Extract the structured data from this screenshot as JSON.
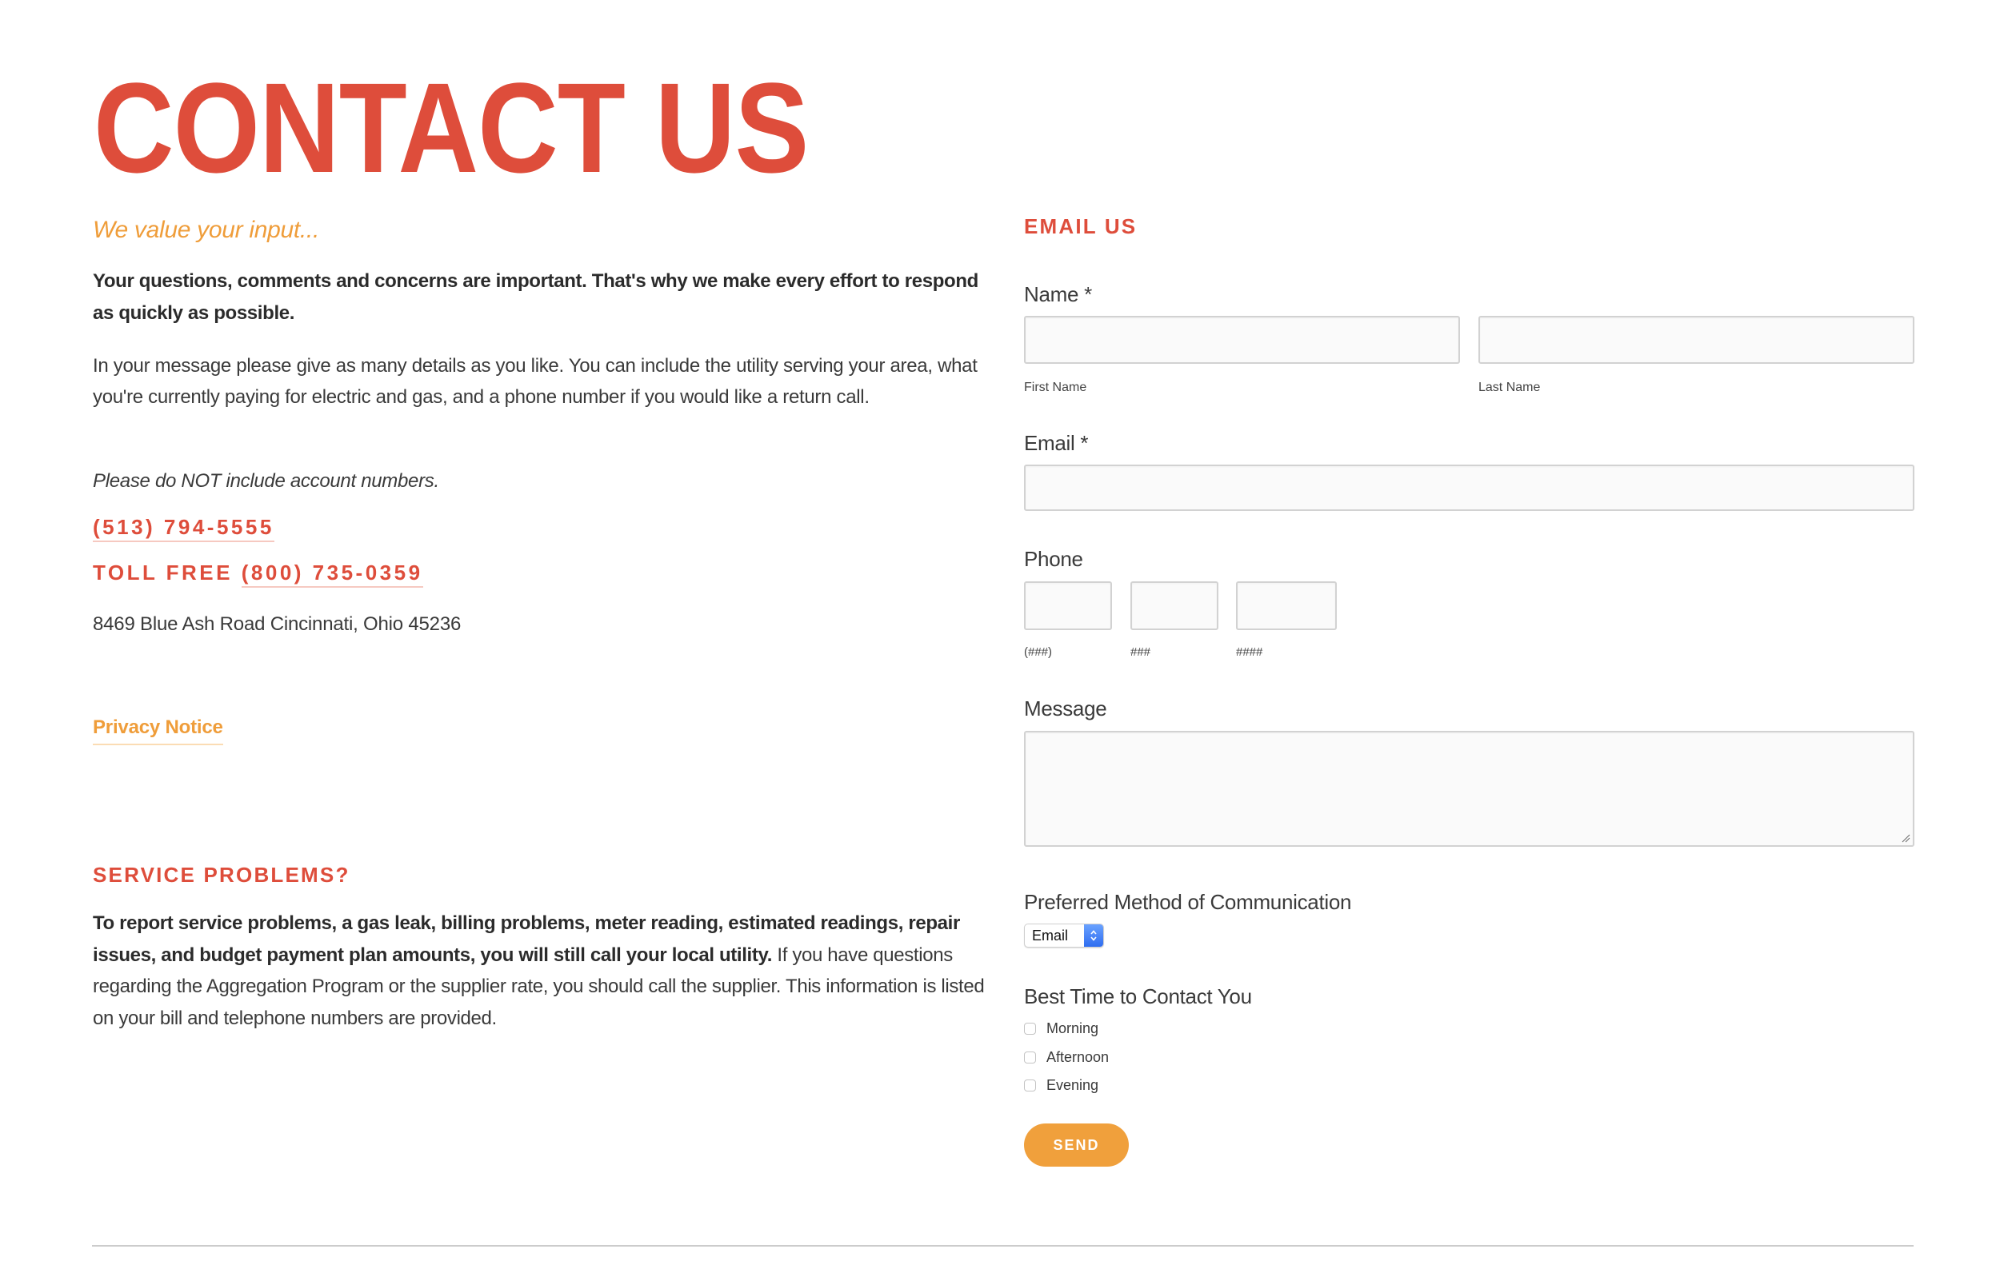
{
  "page": {
    "title": "CONTACT US"
  },
  "intro": {
    "subtitle": "We value your input...",
    "lead": "Your questions, comments and concerns are important. That's why we make every effort to respond as quickly as possible.",
    "details": "In your message please give as many details as you like. You can include the utility serving your area, what you're currently paying for electric and gas, and a phone number if you would like a return call.",
    "note": "Please do NOT include account numbers.",
    "phone": "(513) 794-5555",
    "toll_free_label": "TOLL FREE",
    "toll_free_phone": "(800) 735-0359",
    "address": "8469 Blue Ash Road Cincinnati, Ohio 45236",
    "privacy_link": "Privacy Notice"
  },
  "service": {
    "heading": "SERVICE PROBLEMS?",
    "bold_text": "To report service problems, a gas leak, billing problems, meter reading, estimated readings, repair issues, and budget payment plan amounts, you will still call your local utility.",
    "text": " If you have questions regarding the Aggregation Program or the supplier rate, you should call the supplier. This information is listed on your bill and telephone numbers are provided."
  },
  "form": {
    "heading": "EMAIL US",
    "name": {
      "label": "Name *",
      "first_label": "First Name",
      "first_value": "",
      "last_label": "Last Name",
      "last_value": ""
    },
    "email": {
      "label": "Email *",
      "value": ""
    },
    "phone": {
      "label": "Phone",
      "parts": [
        {
          "hint": "(###)",
          "value": ""
        },
        {
          "hint": "###",
          "value": ""
        },
        {
          "hint": "####",
          "value": ""
        }
      ]
    },
    "message": {
      "label": "Message",
      "value": ""
    },
    "preferred_method": {
      "label": "Preferred Method of Communication",
      "selected": "Email"
    },
    "best_time": {
      "label": "Best Time to Contact You",
      "options": [
        {
          "label": "Morning",
          "checked": false
        },
        {
          "label": "Afternoon",
          "checked": false
        },
        {
          "label": "Evening",
          "checked": false
        }
      ]
    },
    "submit_label": "SEND"
  },
  "colors": {
    "brand_red": "#de4d3b",
    "brand_orange": "#ef9d3a",
    "button_orange": "#f0a03c",
    "text": "#333333"
  }
}
